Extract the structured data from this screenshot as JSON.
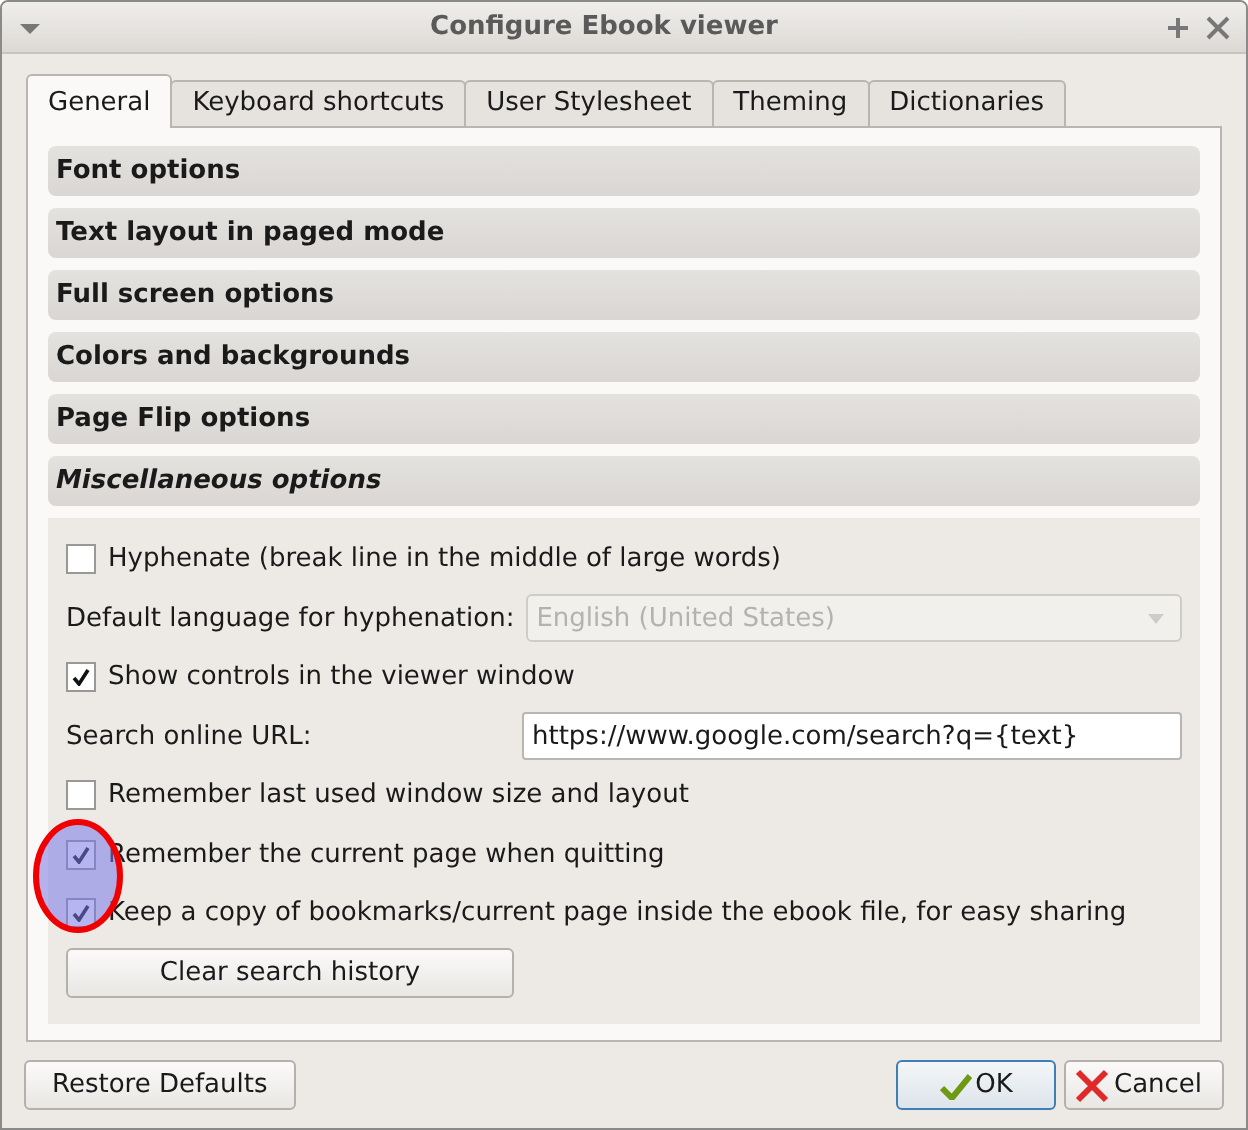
{
  "window": {
    "title": "Configure Ebook viewer"
  },
  "tabs": [
    {
      "label": "General",
      "selected": true
    },
    {
      "label": "Keyboard shortcuts",
      "selected": false
    },
    {
      "label": "User Stylesheet",
      "selected": false
    },
    {
      "label": "Theming",
      "selected": false
    },
    {
      "label": "Dictionaries",
      "selected": false
    }
  ],
  "sections": [
    {
      "title": "Font options",
      "expanded": false
    },
    {
      "title": "Text layout in paged mode",
      "expanded": false
    },
    {
      "title": "Full screen options",
      "expanded": false
    },
    {
      "title": "Colors and backgrounds",
      "expanded": false
    },
    {
      "title": "Page Flip options",
      "expanded": false
    },
    {
      "title": "Miscellaneous options",
      "expanded": true
    }
  ],
  "settings": [
    {
      "kind": "checkbox",
      "label": "Hyphenate (break line in the middle of large words)",
      "checked": false
    },
    {
      "kind": "combo",
      "label": "Default language for hyphenation:",
      "value": "English (United States)",
      "disabled": true
    },
    {
      "kind": "checkbox",
      "label": "Show controls in the viewer window",
      "checked": true
    },
    {
      "kind": "field",
      "label": "Search online URL:",
      "value": "https://www.google.com/search?q={text}"
    },
    {
      "kind": "checkbox",
      "label": "Remember last used window size and layout",
      "checked": false
    },
    {
      "kind": "checkbox",
      "label": "Remember the current page when quitting",
      "checked": true
    },
    {
      "kind": "checkbox",
      "label": "Keep a copy of bookmarks/current page inside the ebook file, for easy sharing",
      "checked": true
    },
    {
      "kind": "button",
      "label": "Clear search history"
    }
  ],
  "annotation": {
    "kind": "circle"
  },
  "buttons": [
    {
      "kind": "plain",
      "label": "Restore Defaults"
    },
    {
      "kind": "ok",
      "label": "OK"
    },
    {
      "kind": "cancel",
      "label": "Cancel"
    }
  ]
}
